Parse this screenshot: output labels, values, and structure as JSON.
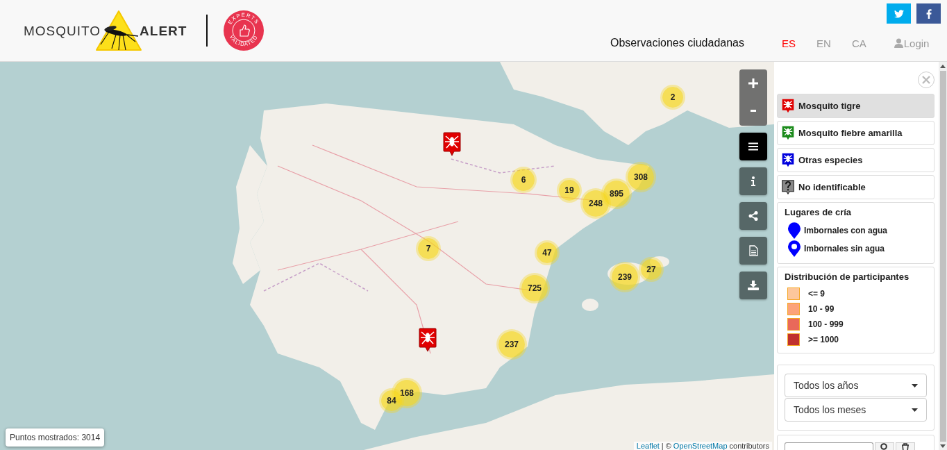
{
  "header": {
    "logo_left": "MOSQUITO",
    "logo_right": "ALERT",
    "badge_top": "EXPERTS",
    "badge_bottom": "VALIDATED",
    "title": "Observaciones ciudadanas",
    "languages": [
      {
        "label": "ES",
        "selected": true
      },
      {
        "label": "EN",
        "selected": false
      },
      {
        "label": "CA",
        "selected": false
      }
    ],
    "login": "Login"
  },
  "map": {
    "clusters": [
      {
        "count": "2"
      },
      {
        "count": "6"
      },
      {
        "count": "19"
      },
      {
        "count": "308"
      },
      {
        "count": "895"
      },
      {
        "count": "248"
      },
      {
        "count": "7"
      },
      {
        "count": "47"
      },
      {
        "count": "239"
      },
      {
        "count": "27"
      },
      {
        "count": "725"
      },
      {
        "count": "237"
      },
      {
        "count": "168"
      },
      {
        "count": "84"
      }
    ],
    "markers": [
      {
        "color": "#e00000"
      },
      {
        "color": "#e00000"
      }
    ],
    "points_shown": "Puntos mostrados: 3014",
    "attribution": {
      "leaflet": "Leaflet",
      "separator": "| ©",
      "osm": "OpenStreetMap",
      "suffix": "contributors"
    }
  },
  "legend": {
    "species": [
      {
        "kind": "species",
        "label": "Mosquito tigre",
        "color": "#e00000",
        "selected": true
      },
      {
        "kind": "species",
        "label": "Mosquito fiebre amarilla",
        "color": "#1a8a1a",
        "selected": false
      },
      {
        "kind": "species",
        "label": "Otras especies",
        "color": "#0000dd",
        "selected": false
      },
      {
        "kind": "unknown",
        "label": "No identificable",
        "color": "#888888",
        "selected": false
      }
    ],
    "breeding": {
      "title": "Lugares de cría",
      "items": [
        {
          "kind": "filled",
          "label": "Imbornales con agua"
        },
        {
          "kind": "hollow",
          "label": "Imbornales sin agua"
        }
      ]
    },
    "distribution": {
      "title": "Distribución de participantes",
      "items": [
        {
          "label": "<= 9",
          "color": "#fdc79c"
        },
        {
          "label": "10 - 99",
          "color": "#fca27a"
        },
        {
          "label": "100 - 999",
          "color": "#e9695a"
        },
        {
          "label": ">= 1000",
          "color": "#c0312e"
        }
      ]
    },
    "filters": [
      {
        "value": "Todos los años"
      },
      {
        "value": "Todos los meses"
      }
    ]
  }
}
